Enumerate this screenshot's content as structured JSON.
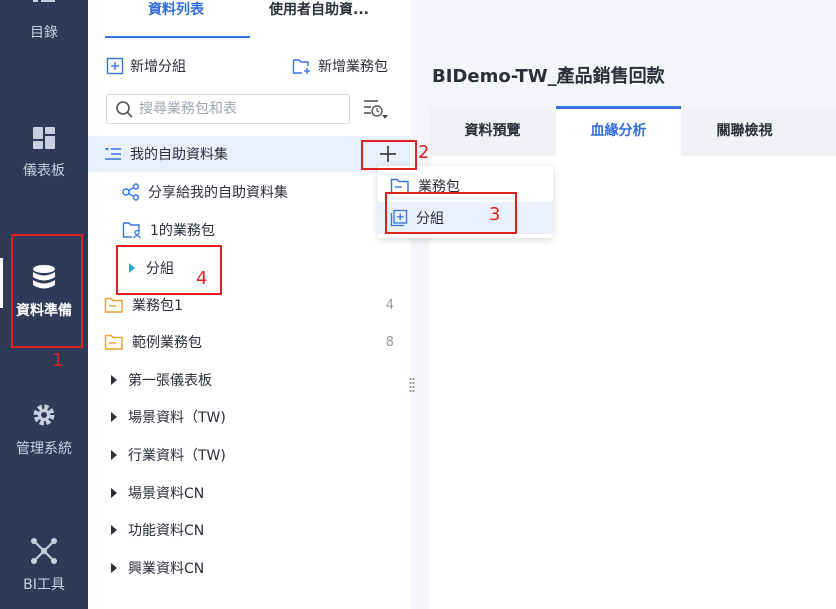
{
  "leftnav": {
    "items": [
      {
        "label": "目錄",
        "icon": "list-icon"
      },
      {
        "label": "儀表板",
        "icon": "dashboard-icon"
      },
      {
        "label": "資料準備",
        "icon": "database-icon",
        "active": true
      },
      {
        "label": "管理系統",
        "icon": "gear-icon"
      },
      {
        "label": "BI工具",
        "icon": "network-icon"
      }
    ]
  },
  "panel": {
    "tabs": [
      {
        "label": "資料列表",
        "active": true
      },
      {
        "label": "使用者自助資..."
      }
    ],
    "add_group_label": "新增分組",
    "add_package_label": "新增業務包",
    "search_placeholder": "搜尋業務包和表",
    "tree": [
      {
        "label": "我的自助資料集",
        "icon": "self-dataset-icon",
        "selected": true
      },
      {
        "label": "分享給我的自助資料集",
        "icon": "share-icon"
      },
      {
        "label": "1的業務包",
        "icon": "user-folder-icon"
      },
      {
        "label": "分組",
        "icon": "caret-right-icon"
      },
      {
        "label": "業務包1",
        "icon": "folder-icon",
        "count": "4"
      },
      {
        "label": "範例業務包",
        "icon": "folder-icon",
        "count": "8"
      },
      {
        "label": "第一張儀表板",
        "icon": "caret-right-icon"
      },
      {
        "label": "場景資料（TW)",
        "icon": "caret-right-icon"
      },
      {
        "label": "行業資料（TW)",
        "icon": "caret-right-icon"
      },
      {
        "label": "場景資料CN",
        "icon": "caret-right-icon"
      },
      {
        "label": "功能資料CN",
        "icon": "caret-right-icon"
      },
      {
        "label": "興業資料CN",
        "icon": "caret-right-icon"
      }
    ]
  },
  "dropdown": {
    "items": [
      {
        "label": "業務包",
        "icon": "package-icon"
      },
      {
        "label": "分組",
        "icon": "add-group-icon",
        "hover": true
      }
    ]
  },
  "main": {
    "title": "BIDemo-TW_產品銷售回款",
    "tabs": [
      {
        "label": "資料預覽"
      },
      {
        "label": "血緣分析",
        "active": true
      },
      {
        "label": "關聯檢視"
      }
    ]
  },
  "annotations": [
    "1",
    "2",
    "3",
    "4"
  ],
  "colors": {
    "nav_bg": "#2e3a56",
    "accent": "#3574e0",
    "annotation": "#e02020",
    "folder": "#f0a030"
  }
}
